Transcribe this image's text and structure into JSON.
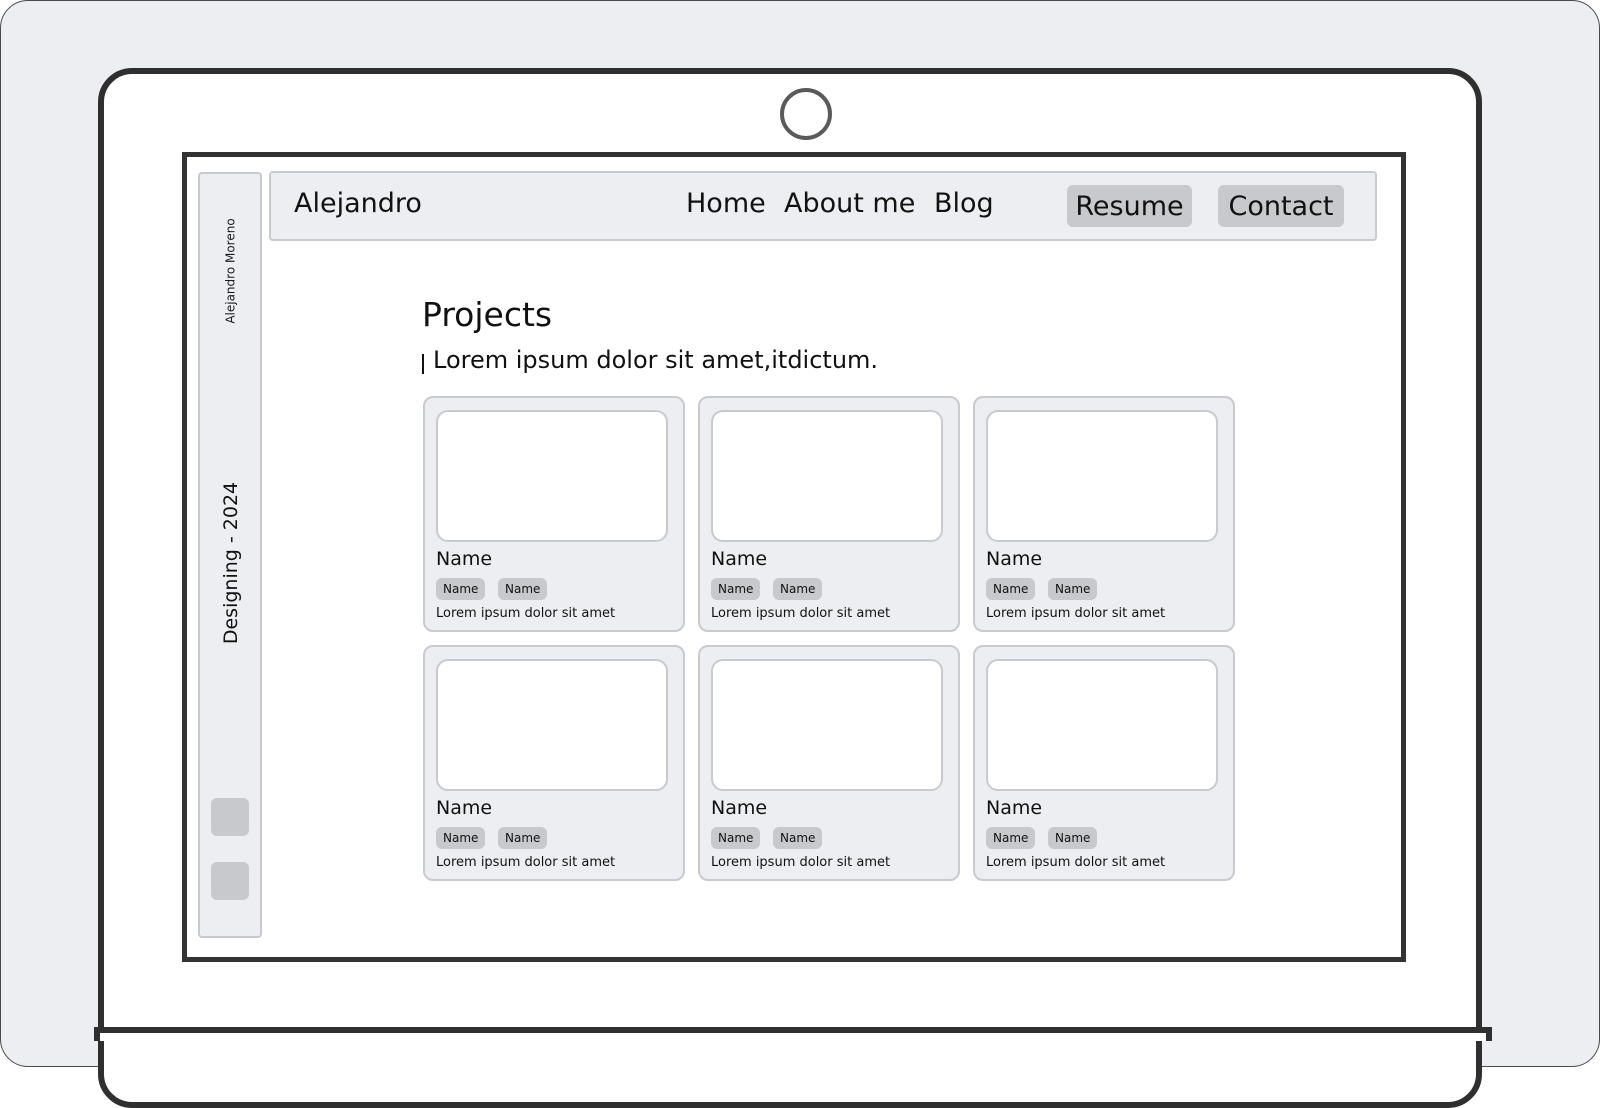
{
  "header": {
    "brand": "Alejandro",
    "nav": [
      "Home",
      "About me",
      "Blog"
    ],
    "resume_label": "Resume",
    "contact_label": "Contact"
  },
  "sidebar": {
    "name": "Alejandro Moreno",
    "year_label": "Designing - 2024"
  },
  "main": {
    "title": "Projects",
    "subtitle": "Lorem ipsum dolor sit amet,itdictum."
  },
  "projects": [
    {
      "name": "Name",
      "tags": [
        "Name",
        "Name"
      ],
      "description": "Lorem ipsum dolor sit amet"
    },
    {
      "name": "Name",
      "tags": [
        "Name",
        "Name"
      ],
      "description": "Lorem ipsum dolor sit amet"
    },
    {
      "name": "Name",
      "tags": [
        "Name",
        "Name"
      ],
      "description": "Lorem ipsum dolor sit amet"
    },
    {
      "name": "Name",
      "tags": [
        "Name",
        "Name"
      ],
      "description": "Lorem ipsum dolor sit amet"
    },
    {
      "name": "Name",
      "tags": [
        "Name",
        "Name"
      ],
      "description": "Lorem ipsum dolor sit amet"
    },
    {
      "name": "Name",
      "tags": [
        "Name",
        "Name"
      ],
      "description": "Lorem ipsum dolor sit amet"
    }
  ],
  "colors": {
    "background": "#edeef1",
    "panel": "#edeef1",
    "button": "#c8c9cd",
    "border": "#c9cacf",
    "frame": "#2f2f2f"
  }
}
